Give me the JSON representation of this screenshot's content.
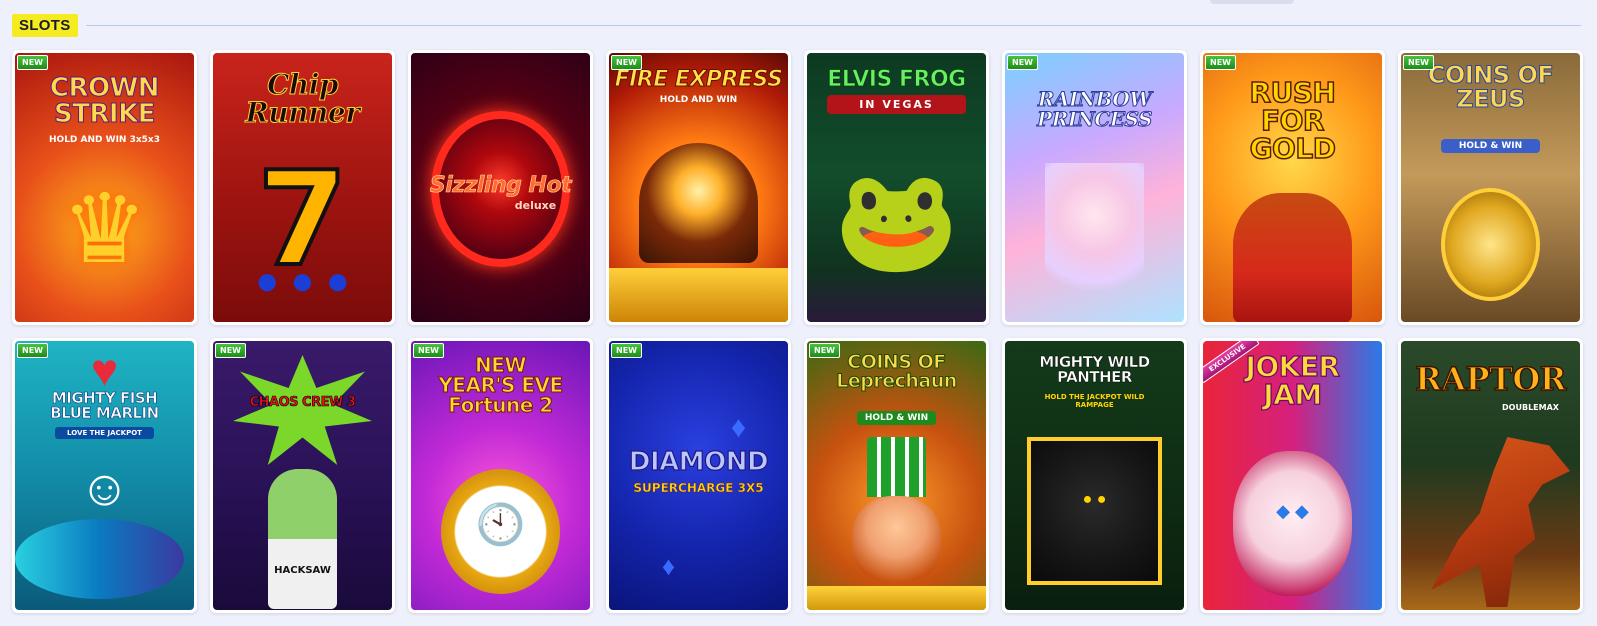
{
  "section": {
    "label": "SLOTS"
  },
  "badges": {
    "new": "NEW",
    "exclusive": "EXCLUSIVE"
  },
  "games": [
    {
      "title": "CROWN STRIKE",
      "subtitle": "HOLD AND WIN 3x5x3",
      "badge": "NEW"
    },
    {
      "title": "Chip Runner",
      "subtitle": "",
      "badge": ""
    },
    {
      "title": "Sizzling Hot",
      "subtitle": "deluxe",
      "badge": ""
    },
    {
      "title": "FIRE EXPRESS",
      "subtitle": "HOLD AND WIN",
      "badge": "NEW"
    },
    {
      "title": "ELVIS FROG",
      "subtitle": "IN VEGAS",
      "badge": ""
    },
    {
      "title": "RAINBOW PRINCESS",
      "subtitle": "",
      "badge": "NEW"
    },
    {
      "title": "RUSH FOR GOLD",
      "subtitle": "",
      "badge": "NEW"
    },
    {
      "title": "COINS OF ZEUS",
      "subtitle": "HOLD & WIN",
      "badge": "NEW"
    },
    {
      "title": "MIGHTY FISH BLUE MARLIN",
      "subtitle": "LOVE THE JACKPOT",
      "badge": "NEW"
    },
    {
      "title": "CHAOS CREW 3",
      "subtitle": "HACKSAW",
      "badge": "NEW"
    },
    {
      "title": "NEW YEAR'S EVE Fortune 2",
      "subtitle": "",
      "badge": "NEW"
    },
    {
      "title": "DIAMOND",
      "subtitle": "SUPERCHARGE 3X5",
      "badge": "NEW"
    },
    {
      "title": "COINS OF Leprechaun",
      "subtitle": "HOLD & WIN",
      "badge": "NEW"
    },
    {
      "title": "MIGHTY WILD PANTHER",
      "subtitle": "HOLD THE JACKPOT WILD RAMPAGE",
      "badge": ""
    },
    {
      "title": "JOKER JAM",
      "subtitle": "",
      "badge": "EXCLUSIVE"
    },
    {
      "title": "RAPTOR",
      "subtitle": "DOUBLEMAX",
      "badge": ""
    }
  ]
}
